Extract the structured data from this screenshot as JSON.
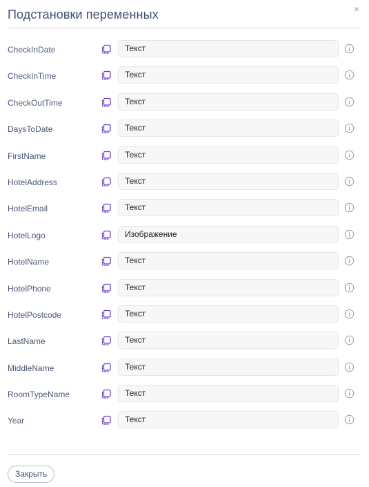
{
  "dialog": {
    "title": "Подстановки переменных",
    "close_icon": "×",
    "close_button_label": "Закрыть"
  },
  "icons": {
    "copy": "copy-icon",
    "info": "info-icon",
    "close": "close-icon"
  },
  "colors": {
    "accent": "#6a3fc8",
    "info_gray": "#9aa3b2",
    "text": "#4a5878"
  },
  "variables": [
    {
      "name": "CheckInDate",
      "type": "Текст"
    },
    {
      "name": "CheckInTime",
      "type": "Текст"
    },
    {
      "name": "CheckOutTime",
      "type": "Текст"
    },
    {
      "name": "DaysToDate",
      "type": "Текст"
    },
    {
      "name": "FirstName",
      "type": "Текст"
    },
    {
      "name": "HotelAddress",
      "type": "Текст"
    },
    {
      "name": "HotelEmail",
      "type": "Текст"
    },
    {
      "name": "HotelLogo",
      "type": "Изображение"
    },
    {
      "name": "HotelName",
      "type": "Текст"
    },
    {
      "name": "HotelPhone",
      "type": "Текст"
    },
    {
      "name": "HotelPostcode",
      "type": "Текст"
    },
    {
      "name": "LastName",
      "type": "Текст"
    },
    {
      "name": "MiddleName",
      "type": "Текст"
    },
    {
      "name": "RoomTypeName",
      "type": "Текст"
    },
    {
      "name": "Year",
      "type": "Текст"
    }
  ]
}
